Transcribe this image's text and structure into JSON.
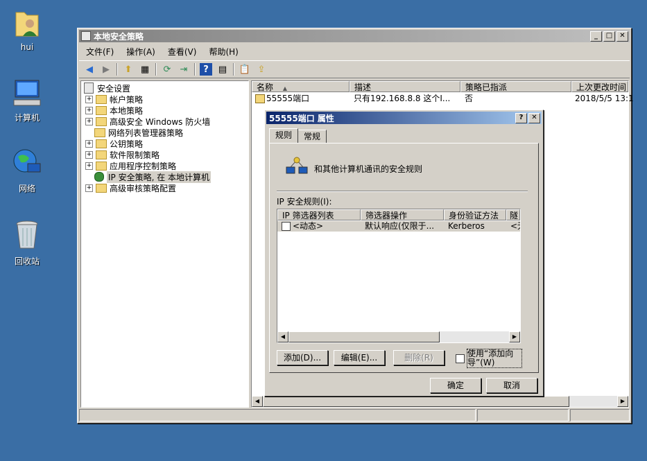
{
  "desktop": {
    "icons": [
      {
        "label": "hui"
      },
      {
        "label": "计算机"
      },
      {
        "label": "网络"
      },
      {
        "label": "回收站"
      }
    ]
  },
  "main_window": {
    "title": "本地安全策略",
    "menu": [
      "文件(F)",
      "操作(A)",
      "查看(V)",
      "帮助(H)"
    ],
    "tree": [
      {
        "label": "安全设置",
        "level": 0
      },
      {
        "label": "帐户策略",
        "level": 1
      },
      {
        "label": "本地策略",
        "level": 1
      },
      {
        "label": "高级安全 Windows 防火墙",
        "level": 1
      },
      {
        "label": "网络列表管理器策略",
        "level": 1
      },
      {
        "label": "公钥策略",
        "level": 1
      },
      {
        "label": "软件限制策略",
        "level": 1
      },
      {
        "label": "应用程序控制策略",
        "level": 1
      },
      {
        "label": "IP 安全策略, 在 本地计算机",
        "level": 1
      },
      {
        "label": "高级审核策略配置",
        "level": 1
      }
    ],
    "list_headers": [
      "名称",
      "描述",
      "策略已指派",
      "上次更改时间"
    ],
    "list_rows": [
      {
        "name": "55555端口",
        "desc": "只有192.168.8.8 这个I...",
        "assigned": "否",
        "modified": "2018/5/5 13:1"
      }
    ]
  },
  "dialog": {
    "title": "55555端口 属性",
    "tabs": [
      "规则",
      "常规"
    ],
    "description": "和其他计算机通讯的安全规则",
    "rules_label": "IP 安全规则(I):",
    "rules_headers": [
      "IP 筛选器列表",
      "筛选器操作",
      "身份验证方法",
      "隧"
    ],
    "rules_rows": [
      {
        "filter": "<动态>",
        "action": "默认响应(仅限于...",
        "auth": "Kerberos",
        "tunnel": "<无"
      }
    ],
    "buttons": {
      "add": "添加(D)...",
      "edit": "编辑(E)...",
      "remove": "删除(R)",
      "wizard": "使用“添加向导”(W)",
      "ok": "确定",
      "cancel": "取消"
    }
  }
}
